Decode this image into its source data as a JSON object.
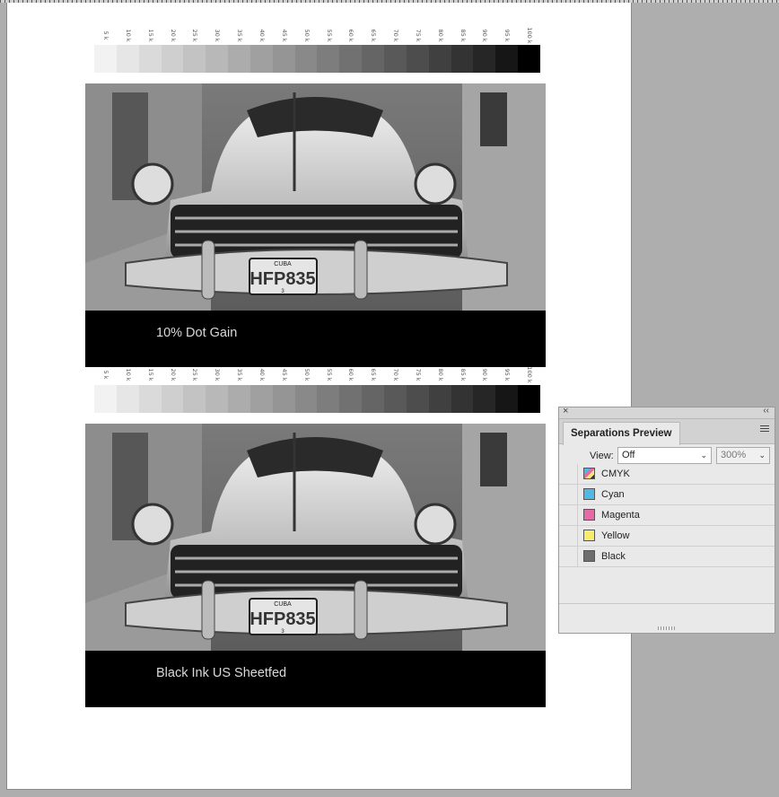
{
  "document": {
    "gray_scale_labels": [
      "5 k",
      "10 k",
      "15 k",
      "20 k",
      "25 k",
      "30 k",
      "35 k",
      "40 k",
      "45 k",
      "50 k",
      "55 k",
      "60 k",
      "65 k",
      "70 k",
      "75 k",
      "80 k",
      "85 k",
      "90 k",
      "95 k",
      "100 k"
    ],
    "gray_scale_colors": [
      "#f2f2f2",
      "#e6e6e6",
      "#dadada",
      "#cfcfcf",
      "#c3c3c3",
      "#b8b8b8",
      "#acacac",
      "#a0a0a0",
      "#959595",
      "#898989",
      "#7d7d7d",
      "#717171",
      "#656565",
      "#595959",
      "#4d4d4d",
      "#404040",
      "#333333",
      "#262626",
      "#161616",
      "#000000"
    ],
    "top_caption": "10% Dot Gain",
    "bottom_caption": "Black Ink US Sheetfed",
    "plate_text_top": "CUBA",
    "plate_text_main": "HFP835",
    "plate_text_small": "3"
  },
  "panel": {
    "title": "Separations Preview",
    "view_label": "View:",
    "view_value": "Off",
    "zoom_value": "300%",
    "close_icon": "close-icon",
    "collapse_icon": "double-chevron-icon",
    "menu_icon": "hamburger-menu-icon",
    "separations": [
      {
        "label": "CMYK",
        "swatch": "cmyk"
      },
      {
        "label": "Cyan",
        "swatch": "#4fb8e6"
      },
      {
        "label": "Magenta",
        "swatch": "#e66aa6"
      },
      {
        "label": "Yellow",
        "swatch": "#f7ec6b"
      },
      {
        "label": "Black",
        "swatch": "#6e6e6e"
      }
    ]
  }
}
